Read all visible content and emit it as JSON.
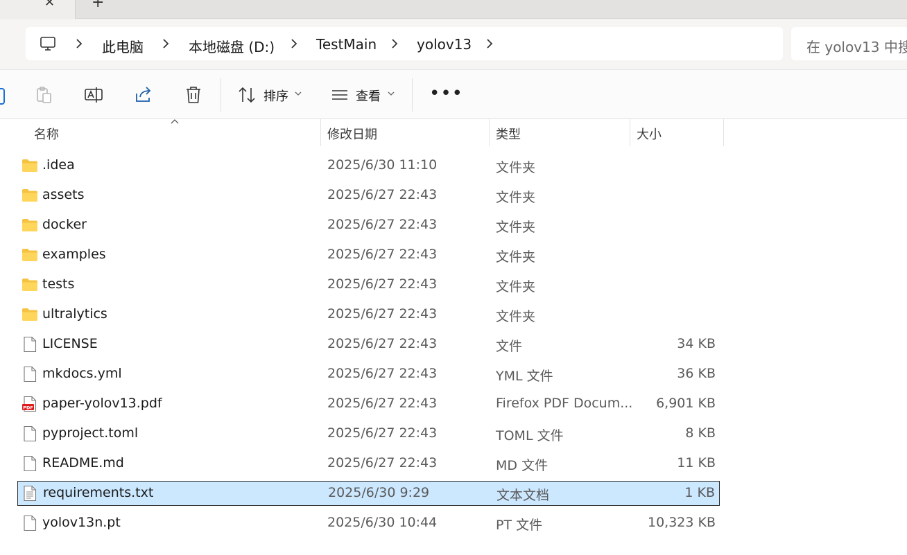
{
  "address": {
    "crumbs": [
      "此电脑",
      "本地磁盘 (D:)",
      "TestMain",
      "yolov13"
    ],
    "search_placeholder": "在 yolov13 中搜"
  },
  "toolbar": {
    "sort_label": "排序",
    "view_label": "查看"
  },
  "columns": {
    "name": "名称",
    "modified": "修改日期",
    "type": "类型",
    "size": "大小"
  },
  "files": [
    {
      "name": ".idea",
      "modified": "2025/6/30 11:10",
      "type": "文件夹",
      "size": "",
      "icon": "folder-icon"
    },
    {
      "name": "assets",
      "modified": "2025/6/27 22:43",
      "type": "文件夹",
      "size": "",
      "icon": "folder-icon"
    },
    {
      "name": "docker",
      "modified": "2025/6/27 22:43",
      "type": "文件夹",
      "size": "",
      "icon": "folder-icon"
    },
    {
      "name": "examples",
      "modified": "2025/6/27 22:43",
      "type": "文件夹",
      "size": "",
      "icon": "folder-icon"
    },
    {
      "name": "tests",
      "modified": "2025/6/27 22:43",
      "type": "文件夹",
      "size": "",
      "icon": "folder-icon"
    },
    {
      "name": "ultralytics",
      "modified": "2025/6/27 22:43",
      "type": "文件夹",
      "size": "",
      "icon": "folder-icon"
    },
    {
      "name": "LICENSE",
      "modified": "2025/6/27 22:43",
      "type": "文件",
      "size": "34 KB",
      "icon": "file-icon"
    },
    {
      "name": "mkdocs.yml",
      "modified": "2025/6/27 22:43",
      "type": "YML 文件",
      "size": "36 KB",
      "icon": "file-icon"
    },
    {
      "name": "paper-yolov13.pdf",
      "modified": "2025/6/27 22:43",
      "type": "Firefox PDF Docum...",
      "size": "6,901 KB",
      "icon": "pdf-icon"
    },
    {
      "name": "pyproject.toml",
      "modified": "2025/6/27 22:43",
      "type": "TOML 文件",
      "size": "8 KB",
      "icon": "file-icon"
    },
    {
      "name": "README.md",
      "modified": "2025/6/27 22:43",
      "type": "MD 文件",
      "size": "11 KB",
      "icon": "file-icon"
    },
    {
      "name": "requirements.txt",
      "modified": "2025/6/30 9:29",
      "type": "文本文档",
      "size": "1 KB",
      "icon": "text-file-icon",
      "selected": true
    },
    {
      "name": "yolov13n.pt",
      "modified": "2025/6/30 10:44",
      "type": "PT 文件",
      "size": "10,323 KB",
      "icon": "file-icon"
    }
  ]
}
